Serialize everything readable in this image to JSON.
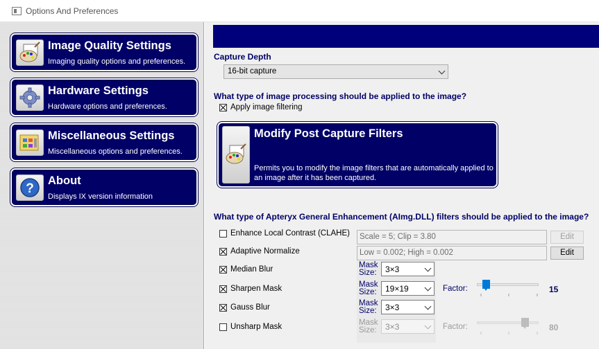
{
  "window": {
    "title": "Options And Preferences"
  },
  "nav": [
    {
      "label": "Image Quality Settings",
      "desc": "Imaging quality options and preferences.",
      "icon": "paint-palette-icon"
    },
    {
      "label": "Hardware Settings",
      "desc": "Hardware options and preferences.",
      "icon": "gear-icon"
    },
    {
      "label": "Miscellaneous Settings",
      "desc": "Miscellaneous options and preferences.",
      "icon": "folder-grid-icon"
    },
    {
      "label": "About",
      "desc": "Displays IX version information",
      "icon": "help-icon"
    }
  ],
  "capture": {
    "label": "Capture Depth",
    "value": "16-bit capture"
  },
  "processing": {
    "question": "What type of image processing should be applied to the image?",
    "apply_filtering": {
      "label": "Apply image filtering",
      "checked": true
    },
    "post_capture": {
      "label": "Modify Post Capture Filters",
      "desc": "Permits you to modify the image filters that are automatically applied to an image after it has been captured."
    }
  },
  "enhancement": {
    "question": "What type of Apteryx General Enhancement (AImg.DLL) filters should be applied to the image?",
    "clahe": {
      "label": "Enhance Local Contrast (CLAHE)",
      "checked": false,
      "value": "Scale = 5; Clip = 3.80",
      "edit": "Edit",
      "enabled": false
    },
    "adaptive": {
      "label": "Adaptive Normalize",
      "checked": true,
      "value": "Low = 0.002; High = 0.002",
      "edit": "Edit",
      "enabled": true
    },
    "median": {
      "label": "Median Blur",
      "checked": true,
      "mask_label": "Mask Size:",
      "mask": "3x3"
    },
    "sharpen": {
      "label": "Sharpen Mask",
      "checked": true,
      "mask_label": "Mask Size:",
      "mask": "19x19",
      "factor_label": "Factor:",
      "factor": "15",
      "factor_fraction": 0.1
    },
    "gauss": {
      "label": "Gauss Blur",
      "checked": true,
      "mask_label": "Mask Size:",
      "mask": "3x3"
    },
    "unsharp": {
      "label": "Unsharp Mask",
      "checked": false,
      "mask_label": "Mask Size:",
      "mask": "3x3",
      "factor_label": "Factor:",
      "factor": "80",
      "factor_fraction": 0.78
    }
  },
  "colors": {
    "nav_bg": "#000066",
    "accent_blue": "#007ad9",
    "heading": "#000066"
  }
}
